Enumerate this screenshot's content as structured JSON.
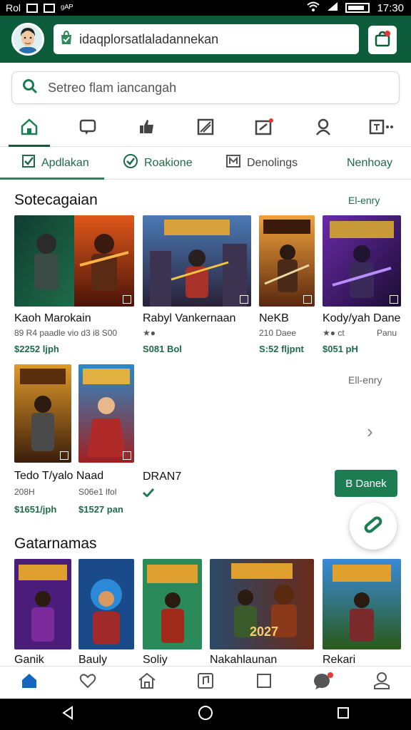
{
  "status_bar": {
    "left_text": "Rol",
    "left_text2": "ᵍᴬᴾ",
    "time": "17:30"
  },
  "app_bar": {
    "url": "idaqplorsatlaladannekan"
  },
  "search": {
    "placeholder": "Setreo flam iancangah"
  },
  "category_tabs": [
    {
      "icon": "home-icon",
      "active": true
    },
    {
      "icon": "chat-icon",
      "active": false
    },
    {
      "icon": "thumbs-up-icon",
      "active": false
    },
    {
      "icon": "slash-box-icon",
      "active": false
    },
    {
      "icon": "edit-box-icon",
      "active": false
    },
    {
      "icon": "person-icon",
      "active": false
    },
    {
      "icon": "more-icon",
      "active": false
    }
  ],
  "sub_tabs": [
    {
      "label": "Apdlakan",
      "icon": "checkbox-icon"
    },
    {
      "label": "Roakione",
      "icon": "check-circle-icon"
    },
    {
      "label": "Denolings",
      "icon": "m-box-icon"
    },
    {
      "label": "Nenhoay",
      "icon": ""
    }
  ],
  "section1": {
    "title": "Sotecagaian",
    "see_more": "El-enry",
    "see_more2": "Ell-enry",
    "cards": [
      {
        "title": "Kaoh Marokain",
        "meta": "89 R4 paadle  vio d3 i8 S00",
        "price": "$2252 ljph"
      },
      {
        "title": "Rabyl Vankernaan",
        "meta": "★●",
        "price": "S081 Bol"
      },
      {
        "title": "NeKB",
        "meta": "210 Daee",
        "price": "S:52 fljpnt"
      },
      {
        "title": "Kody/yah Dane",
        "meta": "★● ct",
        "meta2": "Panu",
        "price": "$051 pH"
      },
      {
        "title": "Tedo T/yalo Naad",
        "meta": "208H",
        "meta2": "S06e1 lfol",
        "price": "$1651/jph"
      },
      {
        "title": "",
        "meta": "",
        "price": "$1527 pan"
      },
      {
        "title": "DRAN7",
        "meta": "",
        "price": ""
      }
    ]
  },
  "download_button": {
    "label": "B Danek"
  },
  "section2": {
    "title": "Gatarnamas",
    "cards": [
      {
        "title": "Ganik"
      },
      {
        "title": "Bauly"
      },
      {
        "title": "Soliy"
      },
      {
        "title": "Nakahlaunan",
        "art_text": "2027"
      },
      {
        "title": "Rekari"
      }
    ]
  },
  "bottom_nav": [
    {
      "icon": "home-filled-icon",
      "active": true
    },
    {
      "icon": "heart-icon",
      "active": false
    },
    {
      "icon": "house-outline-icon",
      "active": false
    },
    {
      "icon": "music-box-icon",
      "active": false
    },
    {
      "icon": "square-icon",
      "active": false
    },
    {
      "icon": "chat-bubble-icon",
      "active": false,
      "badge": true
    },
    {
      "icon": "profile-icon",
      "active": false
    }
  ],
  "colors": {
    "brand": "#0d5c3b",
    "accent": "#1d7d52",
    "badge": "#e53935"
  }
}
